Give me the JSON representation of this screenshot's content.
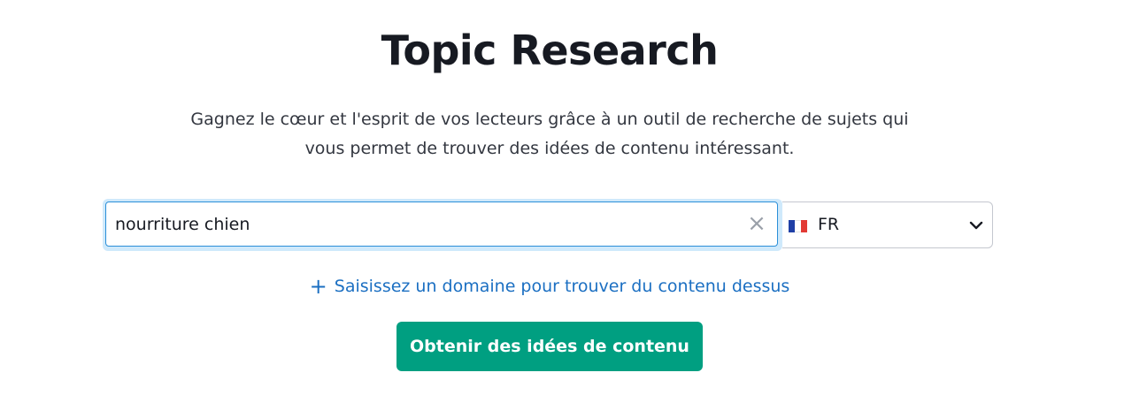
{
  "header": {
    "title": "Topic Research",
    "subtitle_line1": "Gagnez le cœur et l'esprit de vos lecteurs grâce à un outil de recherche de sujets qui",
    "subtitle_line2": "vous permet de trouver des idées de contenu intéressant."
  },
  "search": {
    "value": "nourriture chien",
    "clear_icon": "close-icon",
    "clear_glyph": "×"
  },
  "country": {
    "selected": "FR",
    "flag": "france-flag-icon",
    "chevron": "chevron-down-icon"
  },
  "domain_link": {
    "plus_glyph": "+",
    "label": "Saisissez un domaine pour trouver du contenu dessus"
  },
  "cta": {
    "label": "Obtenir des idées de contenu"
  },
  "colors": {
    "accent_green": "#009f81",
    "link_blue": "#1b6fc2",
    "focus_blue": "#2b8fd8"
  }
}
